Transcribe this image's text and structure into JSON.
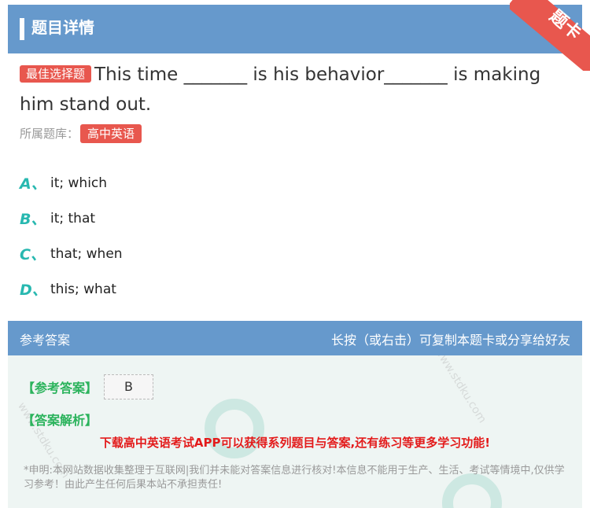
{
  "header": {
    "title": "题目详情",
    "corner_badge": "题卡"
  },
  "question": {
    "tag": "最佳选择题",
    "text": "This time _______ is his behavior_______ is making him stand out."
  },
  "bank": {
    "label": "所属题库：",
    "value": "高中英语"
  },
  "options": [
    {
      "letter": "A、",
      "text": "it; which"
    },
    {
      "letter": "B、",
      "text": "it; that"
    },
    {
      "letter": "C、",
      "text": "that; when"
    },
    {
      "letter": "D、",
      "text": "this; what"
    }
  ],
  "answer_section": {
    "left_label": "参考答案",
    "right_label": "长按（或右击）可复制本题卡或分享给好友",
    "ref_label": "【参考答案】",
    "ref_value": "B",
    "explanation_label": "【答案解析】",
    "promo": "下载高中英语考试APP可以获得系列题目与答案,还有练习等更多学习功能!",
    "disclaimer": "*申明:本网站数据收集整理于互联网|我们并未能对答案信息进行核对!本信息不能用于生产、生活、考试等情境中,仅供学习参考！由此产生任何后果本站不承担责任!"
  },
  "colors": {
    "header_bg": "#6699cc",
    "accent_red": "#e8574e",
    "option_letter": "#28b8b0",
    "answer_green": "#2bb35c"
  },
  "watermark": {
    "site": "www.stdku.com"
  }
}
